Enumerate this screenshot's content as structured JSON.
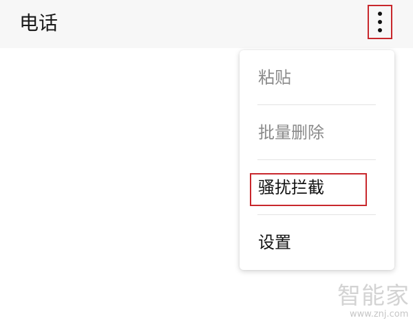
{
  "app_bar": {
    "title": "电话",
    "more_icon": "more-vertical-icon"
  },
  "menu": {
    "items": [
      {
        "label": "粘贴",
        "state": "disabled"
      },
      {
        "label": "批量删除",
        "state": "disabled"
      },
      {
        "label": "骚扰拦截",
        "state": "enabled",
        "highlighted": true
      },
      {
        "label": "设置",
        "state": "enabled"
      }
    ]
  },
  "annotation": {
    "color": "#c8262b"
  },
  "watermark": {
    "logo": "智能家",
    "url": "www.znj.com"
  }
}
